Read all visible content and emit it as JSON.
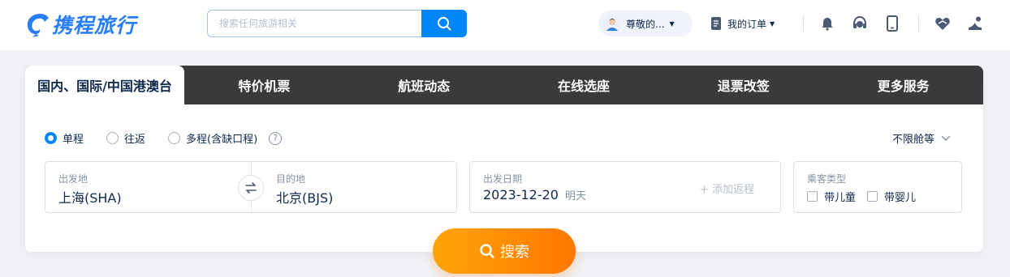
{
  "header": {
    "logo_text": "携程旅行",
    "search_placeholder": "搜索任何旅游相关",
    "user_name": "尊敬的...",
    "orders_label": "我的订单"
  },
  "tabs": [
    {
      "label": "国内、国际/中国港澳台",
      "active": true
    },
    {
      "label": "特价机票",
      "active": false
    },
    {
      "label": "航班动态",
      "active": false
    },
    {
      "label": "在线选座",
      "active": false
    },
    {
      "label": "退票改签",
      "active": false
    },
    {
      "label": "更多服务",
      "active": false
    }
  ],
  "trip_types": [
    {
      "label": "单程",
      "checked": true
    },
    {
      "label": "往返",
      "checked": false
    },
    {
      "label": "多程(含缺口程)",
      "checked": false
    }
  ],
  "cabin_label": "不限舱等",
  "route": {
    "from_label": "出发地",
    "from_value": "上海(SHA)",
    "to_label": "目的地",
    "to_value": "北京(BJS)"
  },
  "dates": {
    "depart_label": "出发日期",
    "depart_value": "2023-12-20",
    "depart_hint": "明天",
    "add_return": "+ 添加返程"
  },
  "passengers": {
    "label": "乘客类型",
    "options": [
      "带儿童",
      "带婴儿"
    ]
  },
  "search_button": "搜索",
  "colors": {
    "brand_blue": "#0086f6",
    "logo_blue": "#287dfa",
    "tab_dark": "#3a3a3d",
    "search_orange_start": "#ffa50a",
    "search_orange_end": "#ff7700",
    "text_primary": "#0f294d"
  }
}
